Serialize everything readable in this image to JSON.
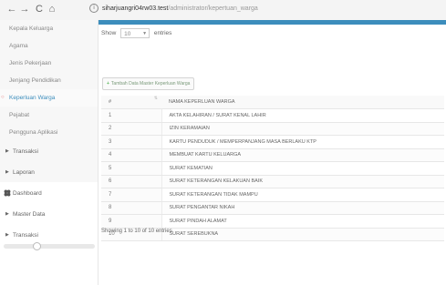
{
  "browser": {
    "back": "←",
    "forward": "→",
    "reload": "C",
    "home": "⌂",
    "url_host": "siharjuangri04rw03.test",
    "url_path": "/administrator/kepertuan_warga"
  },
  "sidebar": {
    "sub_items": [
      {
        "label": "Kepala Keluarga"
      },
      {
        "label": "Agama"
      },
      {
        "label": "Jenis Pekerjaan"
      },
      {
        "label": "Jenjang Pendidikan"
      },
      {
        "label": "Keperluan Warga",
        "active": true
      },
      {
        "label": "Pejabat"
      },
      {
        "label": "Pengguna Aplikasi"
      }
    ],
    "main_items": [
      {
        "label": "Transaksi",
        "icon": "chevron-right-icon"
      },
      {
        "label": "Laporan",
        "icon": "chevron-right-icon"
      },
      {
        "label": "Dashboard",
        "icon": "dashboard-icon"
      },
      {
        "label": "Master Data",
        "icon": "chevron-right-icon"
      },
      {
        "label": "Transaksi",
        "icon": "chevron-right-icon"
      }
    ]
  },
  "controls": {
    "show_label": "Show",
    "show_value": "10",
    "entries_label": "entries"
  },
  "add_button": "Tambah Data Master Keperluan Warga",
  "table": {
    "headers": [
      "#",
      "NAMA KEPERLUAN WARGA"
    ],
    "rows": [
      [
        "1",
        "AKTA KELAHIRAN / SURAT KENAL LAHIR"
      ],
      [
        "2",
        "IZIN KERAMAIAN"
      ],
      [
        "3",
        "KARTU PENDUDUK / MEMPERPANJANG MASA BERLAKU KTP"
      ],
      [
        "4",
        "MEMBUAT KARTU KELUARGA"
      ],
      [
        "5",
        "SURAT KEMATIAN"
      ],
      [
        "6",
        "SURAT KETERANGAN KELAKUAN BAIK"
      ],
      [
        "7",
        "SURAT KETERANGAN TIDAK MAMPU"
      ],
      [
        "8",
        "SURAT PENGANTAR NIKAH"
      ],
      [
        "9",
        "SURAT PINDAH ALAMAT"
      ],
      [
        "10",
        "SURAT SEREBUKNA"
      ]
    ]
  },
  "footer": "Showing 1 to 10 of 10 entries",
  "colors": {
    "accent": "#3c8dbc",
    "active_caret": "#e07a7a"
  }
}
